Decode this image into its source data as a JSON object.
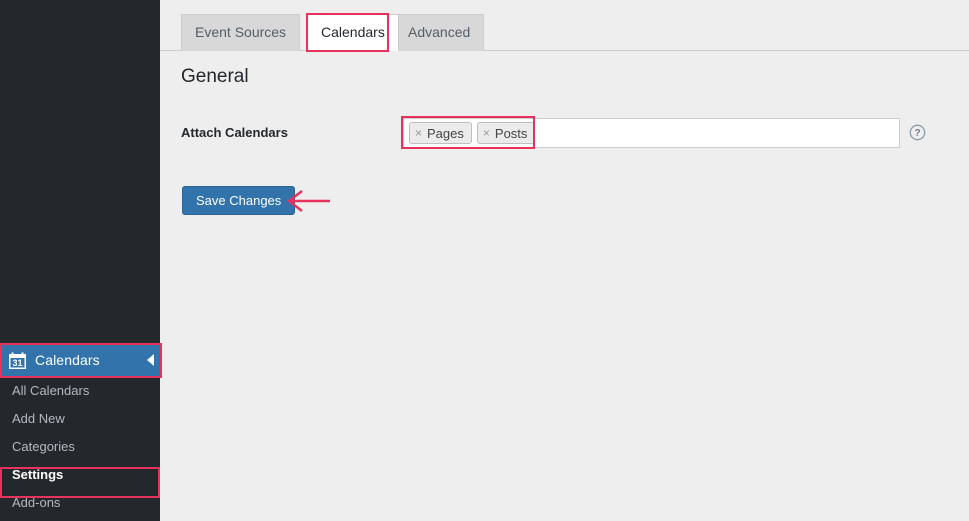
{
  "sidebar": {
    "menu": {
      "label": "Calendars",
      "icon": "calendar-31-icon",
      "collapse_icon": "chevron-left-icon",
      "active_color": "#3273ac",
      "highlighted": true
    },
    "submenu": [
      {
        "label": "All Calendars",
        "current": false,
        "highlighted": false
      },
      {
        "label": "Add New",
        "current": false,
        "highlighted": false
      },
      {
        "label": "Categories",
        "current": false,
        "highlighted": false
      },
      {
        "label": "Settings",
        "current": true,
        "highlighted": true
      },
      {
        "label": "Add-ons",
        "current": false,
        "highlighted": false
      }
    ],
    "background": "#23282d",
    "text_color": "#b4b9be"
  },
  "tabs": [
    {
      "label": "Event Sources",
      "active": false,
      "highlighted": false
    },
    {
      "label": "Calendars",
      "active": true,
      "highlighted": true
    },
    {
      "label": "Advanced",
      "active": false,
      "highlighted": false
    }
  ],
  "main": {
    "section_title": "General",
    "field": {
      "label": "Attach Calendars",
      "tokens": [
        {
          "remove_icon": "×",
          "label": "Pages"
        },
        {
          "remove_icon": "×",
          "label": "Posts"
        }
      ],
      "placeholder": "",
      "value": "",
      "help_icon": "question-mark-circle-icon",
      "highlighted": true
    },
    "save_button": {
      "label": "Save Changes",
      "color": "#3273ac"
    }
  },
  "annotations": {
    "color": "#e8315c",
    "arrow": {
      "direction": "left",
      "icon": "arrow-left-annotation"
    }
  }
}
